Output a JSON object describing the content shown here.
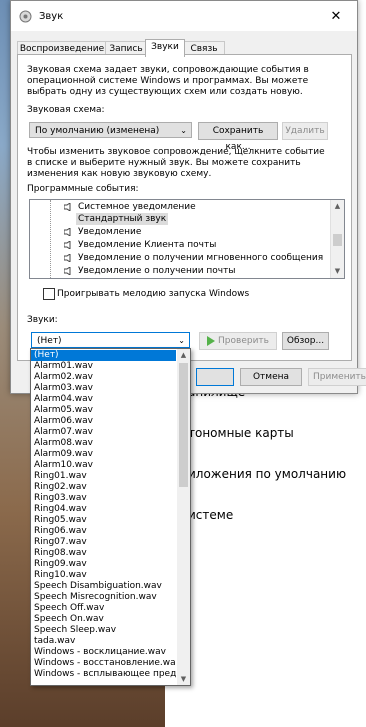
{
  "window": {
    "title": "Звук"
  },
  "tabs": [
    {
      "label": "Воспроизведение"
    },
    {
      "label": "Запись"
    },
    {
      "label": "Звуки"
    },
    {
      "label": "Связь"
    }
  ],
  "description": "Звуковая схема задает звуки, сопровождающие события в операционной системе Windows и программах. Вы можете выбрать одну из существующих схем или создать новую.",
  "scheme": {
    "label": "Звуковая схема:",
    "value": "По умолчанию (изменена)",
    "save_button": "Сохранить как...",
    "delete_button": "Удалить"
  },
  "change_hint": "Чтобы изменить звуковое сопровождение, щелкните событие в списке и выберите нужный звук. Вы можете сохранить изменения как новую звуковую схему.",
  "events": {
    "label": "Программные события:",
    "items": [
      {
        "label": "Системное уведомление"
      },
      {
        "label": "Стандартный звук"
      },
      {
        "label": "Уведомление"
      },
      {
        "label": "Уведомление Клиента почты"
      },
      {
        "label": "Уведомление о получении мгновенного сообщения"
      },
      {
        "label": "Уведомление о получении почты"
      }
    ]
  },
  "startup_checkbox": {
    "label": "Проигрывать мелодию запуска Windows",
    "checked": false
  },
  "sounds": {
    "label": "Звуки:",
    "value": "(Нет)",
    "test_button": "Проверить",
    "browse_button": "Обзор..."
  },
  "footer": {
    "cancel_button": "Отмена",
    "apply_button": "Применить"
  },
  "dropdown": {
    "options": [
      "(Нет)",
      "Alarm01.wav",
      "Alarm02.wav",
      "Alarm03.wav",
      "Alarm04.wav",
      "Alarm05.wav",
      "Alarm06.wav",
      "Alarm07.wav",
      "Alarm08.wav",
      "Alarm09.wav",
      "Alarm10.wav",
      "Ring01.wav",
      "Ring02.wav",
      "Ring03.wav",
      "Ring04.wav",
      "Ring05.wav",
      "Ring06.wav",
      "Ring07.wav",
      "Ring08.wav",
      "Ring09.wav",
      "Ring10.wav",
      "Speech Disambiguation.wav",
      "Speech Misrecognition.wav",
      "Speech Off.wav",
      "Speech On.wav",
      "Speech Sleep.wav",
      "tada.wav",
      "Windows - восклицание.wav",
      "Windows - восстановление.wav",
      "Windows - всплывающее преду"
    ],
    "selected_index": 0
  },
  "background_settings": {
    "items": [
      "анилище",
      "тономные карты",
      "иложения по умолчанию",
      "истеме"
    ]
  },
  "colors": {
    "highlight": "#0078d7",
    "play_icon": "#55b24a"
  }
}
